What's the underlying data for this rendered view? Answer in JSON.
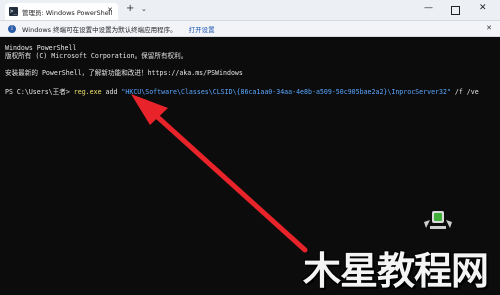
{
  "tabbar": {
    "tab_icon_glyph": ">_",
    "tab_title": "管理员: Windows PowerShell",
    "close_glyph": "✕",
    "new_tab_glyph": "+",
    "dropdown_glyph": "⌄",
    "minimize_glyph": "—",
    "close_window_glyph": "✕"
  },
  "infobar": {
    "icon_glyph": "i",
    "message": "Windows 终端可在设置中设置为默认终端应用程序。",
    "link": "打开设置",
    "close_glyph": "✕"
  },
  "terminal": {
    "line1": "Windows PowerShell",
    "line2": "版权所有 (C)  Microsoft Corporation。保留所有权利。",
    "line3": "安装最新的 PowerShell，了解新功能和改进！https://aka.ms/PSWindows",
    "prompt": "PS C:\\Users\\王者> ",
    "command": "reg.exe",
    "verb": " add ",
    "key_path": "\"HKCU\\Software\\Classes\\CLSID\\{86ca1aa0-34aa-4e8b-a509-50c905bae2a2}\\InprocServer32\"",
    "flags": " /f /ve"
  },
  "annotation": {
    "arrow_color": "#e8232a"
  },
  "watermark": {
    "text": "木星教程网"
  }
}
